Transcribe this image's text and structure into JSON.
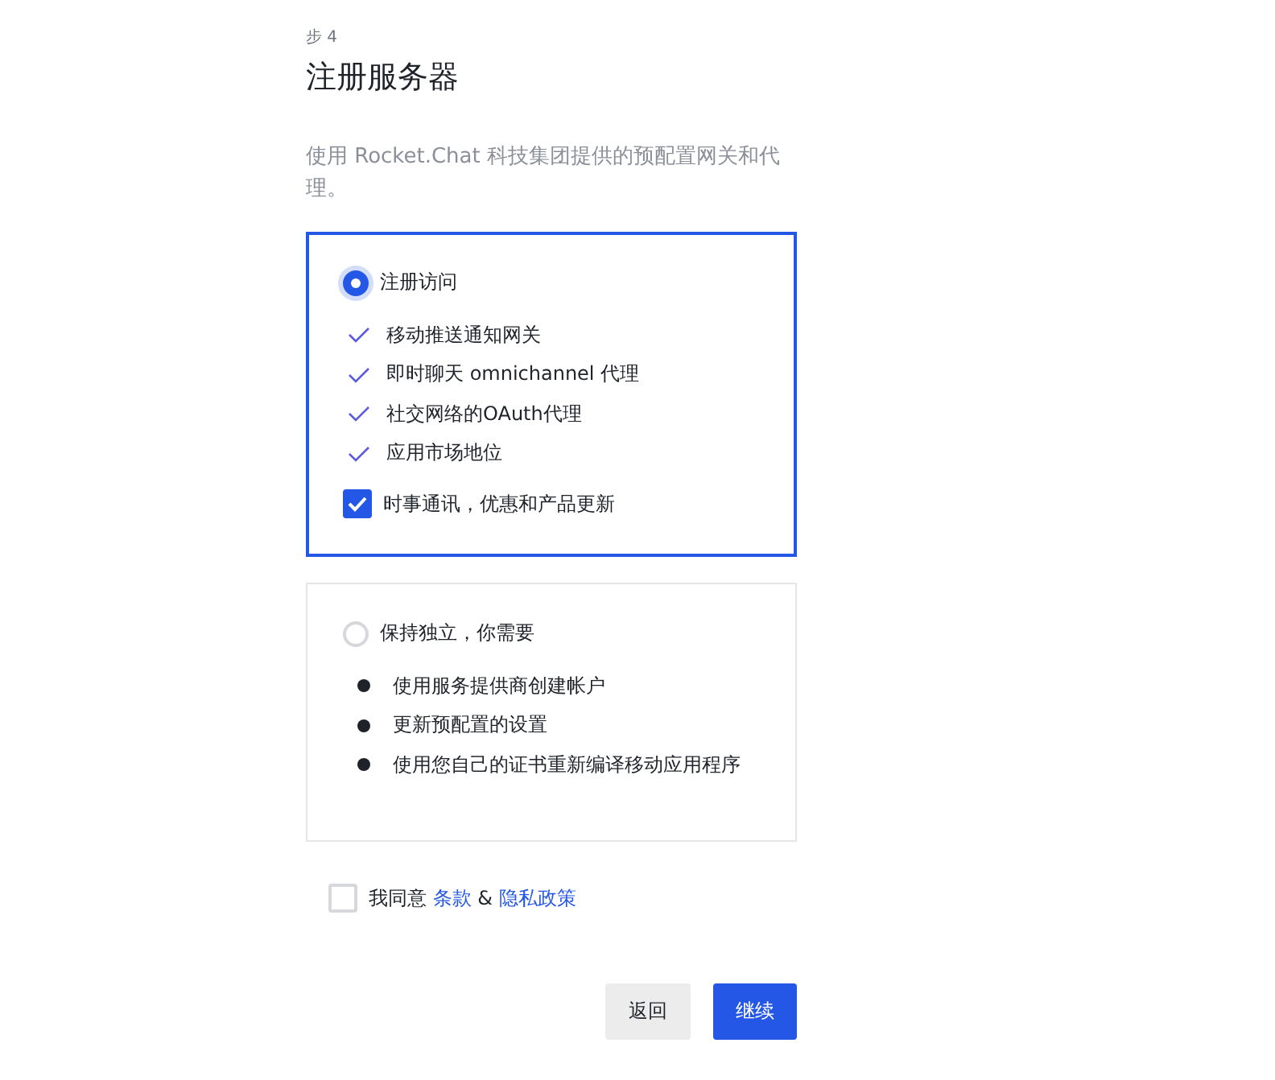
{
  "step": "步 4",
  "title": "注册服务器",
  "description": "使用 Rocket.Chat 科技集团提供的预配置网关和代理。",
  "options": [
    {
      "label": "注册访问",
      "selected": true,
      "kind": "check",
      "items": [
        "移动推送通知网关",
        "即时聊天 omnichannel 代理",
        "社交网络的OAuth代理",
        "应用市场地位"
      ],
      "newsletter": {
        "label": "时事通讯，优惠和产品更新",
        "checked": true
      }
    },
    {
      "label": "保持独立，你需要",
      "selected": false,
      "kind": "bullet",
      "items": [
        "使用服务提供商创建帐户",
        "更新预配置的设置",
        "使用您自己的证书重新编译移动应用程序"
      ]
    }
  ],
  "agree": {
    "checked": false,
    "prefix": "我同意",
    "terms": "条款",
    "separator": "&",
    "privacy": "隐私政策"
  },
  "buttons": [
    {
      "label": "返回",
      "kind": "secondary"
    },
    {
      "label": "继续",
      "kind": "primary"
    }
  ]
}
